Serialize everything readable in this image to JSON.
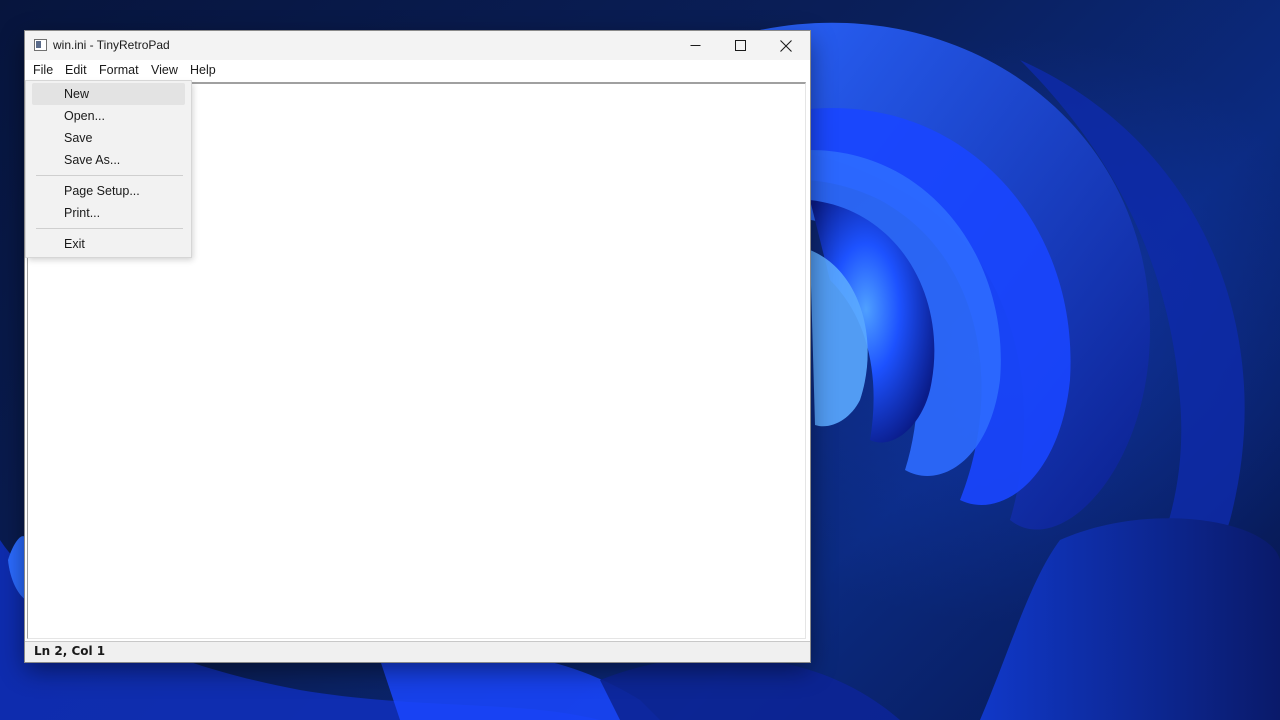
{
  "window": {
    "title": "win.ini - TinyRetroPad",
    "minimize_icon": "minimize-icon",
    "maximize_icon": "maximize-icon",
    "close_icon": "close-icon"
  },
  "menubar": {
    "items": [
      "File",
      "Edit",
      "Format",
      "View",
      "Help"
    ],
    "active": "File"
  },
  "file_menu": {
    "new": "New",
    "open": "Open...",
    "save": "Save",
    "save_as": "Save As...",
    "page_setup": "Page Setup...",
    "print": "Print...",
    "exit": "Exit",
    "highlighted": "New"
  },
  "editor": {
    "content": ""
  },
  "statusbar": {
    "position": "Ln 2, Col 1"
  },
  "colors": {
    "accent": "#1a4fff",
    "wallpaper_dark": "#07153d"
  }
}
